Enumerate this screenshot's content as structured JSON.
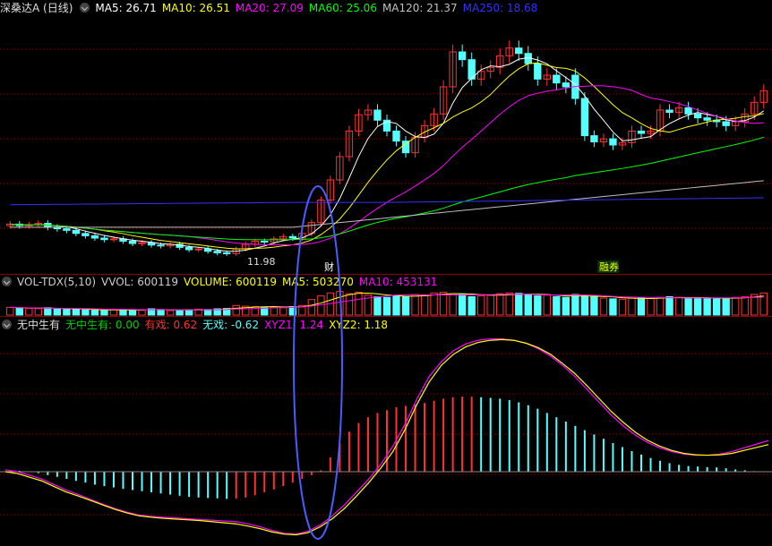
{
  "header": {
    "title": "深桑达A (日线)",
    "ma5": "MA5: 26.71",
    "ma10": "MA10: 26.51",
    "ma20": "MA20: 27.09",
    "ma60": "MA60: 25.06",
    "ma120": "MA120: 21.37",
    "ma250": "MA250: 18.68"
  },
  "volume_header": {
    "title": "VOL-TDX(5,10)",
    "vvol": "VVOL: 600119",
    "volume": "VOLUME: 600119",
    "ma5": "MA5: 503270",
    "ma10": "MA10: 453131"
  },
  "indicator_header": {
    "title": "无中生有",
    "wzsy": "无中生有: 0.00",
    "youxi": "有戏: 0.62",
    "wuxi": "无戏: -0.62",
    "xyz1": "XYZ1: 1.24",
    "xyz2": "XYZ2: 1.18"
  },
  "annotations": {
    "low_price": "11.98",
    "tag1": "财",
    "tag2": "融券"
  },
  "colors": {
    "up": "#ff3232",
    "down": "#54ffff",
    "ma5": "#ffffff",
    "ma10": "#ffff00",
    "ma20": "#ff00ff",
    "ma60": "#00ff00",
    "ma120": "#c0c0c0",
    "ma250": "#3232ff",
    "ellipse": "#4a5cff"
  },
  "chart_data": [
    {
      "type": "candlestick",
      "name": "price",
      "price_range": [
        11.98,
        40.5
      ],
      "closes": [
        15.8,
        15.6,
        15.7,
        15.9,
        15.4,
        15.2,
        15.0,
        14.6,
        14.3,
        14.0,
        13.8,
        13.9,
        13.6,
        13.3,
        13.4,
        13.1,
        13.0,
        13.2,
        12.8,
        12.5,
        12.6,
        12.3,
        12.1,
        11.98,
        12.6,
        13.2,
        13.6,
        13.5,
        13.9,
        14.2,
        14.0,
        14.6,
        16.0,
        18.9,
        21.5,
        24.5,
        27.8,
        29.9,
        30.5,
        29.2,
        27.8,
        26.5,
        25.0,
        27.0,
        28.5,
        30.0,
        33.5,
        38.0,
        37.0,
        34.5,
        35.5,
        36.0,
        37.5,
        38.5,
        37.8,
        36.5,
        34.5,
        35.0,
        34.0,
        33.5,
        32.0,
        27.2,
        26.4,
        26.8,
        26.0,
        26.3,
        27.8,
        27.5,
        27.8,
        30.5,
        30.2,
        30.8,
        30.0,
        29.5,
        29.2,
        29.0,
        28.5,
        29.0,
        30.0,
        31.5,
        33.0
      ],
      "opens": [
        15.6,
        15.8,
        15.6,
        15.7,
        15.9,
        15.4,
        15.2,
        15.0,
        14.6,
        14.3,
        14.0,
        13.8,
        13.9,
        13.6,
        13.3,
        13.4,
        13.1,
        13.0,
        13.2,
        12.8,
        12.5,
        12.6,
        12.3,
        12.1,
        12.0,
        12.6,
        13.2,
        13.6,
        13.5,
        13.9,
        14.2,
        14.0,
        14.6,
        16.0,
        18.9,
        21.5,
        24.5,
        27.8,
        29.9,
        30.5,
        29.2,
        27.8,
        26.5,
        25.0,
        27.0,
        28.5,
        30.0,
        33.5,
        38.0,
        37.0,
        34.5,
        35.5,
        36.0,
        37.5,
        38.5,
        37.8,
        36.5,
        34.5,
        35.0,
        34.0,
        35.0,
        32.0,
        27.2,
        26.4,
        26.8,
        26.0,
        26.3,
        27.8,
        27.5,
        27.8,
        30.5,
        30.2,
        30.8,
        30.0,
        29.5,
        29.2,
        29.0,
        28.5,
        29.0,
        30.0,
        31.5
      ]
    },
    {
      "type": "bar",
      "name": "volume",
      "values": [
        210,
        190,
        180,
        175,
        200,
        160,
        150,
        170,
        140,
        130,
        120,
        160,
        150,
        140,
        130,
        170,
        150,
        120,
        130,
        140,
        160,
        150,
        170,
        180,
        260,
        240,
        230,
        210,
        220,
        200,
        230,
        260,
        420,
        520,
        600,
        640,
        580,
        620,
        540,
        500,
        480,
        520,
        510,
        560,
        540,
        600,
        620,
        580,
        560,
        500,
        520,
        540,
        580,
        600,
        590,
        550,
        520,
        540,
        500,
        480,
        560,
        520,
        500,
        460,
        440,
        430,
        460,
        470,
        450,
        480,
        500,
        480,
        470,
        460,
        450,
        440,
        460,
        480,
        500,
        560,
        600
      ]
    },
    {
      "type": "bar",
      "name": "无中生有",
      "values": [
        0.05,
        0.03,
        0.0,
        -0.05,
        -0.12,
        -0.18,
        -0.25,
        -0.32,
        -0.38,
        -0.45,
        -0.5,
        -0.55,
        -0.6,
        -0.64,
        -0.68,
        -0.72,
        -0.76,
        -0.8,
        -0.84,
        -0.88,
        -0.9,
        -0.92,
        -0.93,
        -0.95,
        -0.94,
        -0.9,
        -0.82,
        -0.72,
        -0.62,
        -0.5,
        -0.38,
        -0.25,
        -0.12,
        0.05,
        0.5,
        1.0,
        1.4,
        1.7,
        1.9,
        2.05,
        2.15,
        2.25,
        2.3,
        2.35,
        2.4,
        2.48,
        2.55,
        2.6,
        2.62,
        2.62,
        2.6,
        2.58,
        2.55,
        2.5,
        2.42,
        2.32,
        2.2,
        2.05,
        1.9,
        1.75,
        1.6,
        1.45,
        1.3,
        1.15,
        1.0,
        0.86,
        0.72,
        0.6,
        0.48,
        0.38,
        0.3,
        0.24,
        0.2,
        0.18,
        0.16,
        0.15,
        0.12,
        0.08,
        0.05,
        0.02,
        0.0
      ],
      "xyz1": [
        0.05,
        0.0,
        -0.1,
        -0.2,
        -0.35,
        -0.5,
        -0.62,
        -0.75,
        -0.88,
        -1.0,
        -1.1,
        -1.18,
        -1.22,
        -1.24,
        -1.26,
        -1.28,
        -1.3,
        -1.32,
        -1.34,
        -1.36,
        -1.42,
        -1.5,
        -1.6,
        -1.68,
        -1.7,
        -1.62,
        -1.45,
        -1.2,
        -0.9,
        -0.55,
        -0.2,
        0.2,
        0.7,
        1.3,
        2.0,
        2.6,
        3.0,
        3.3,
        3.48,
        3.58,
        3.62,
        3.62,
        3.58,
        3.5,
        3.35,
        3.15,
        2.9,
        2.6,
        2.25,
        1.9,
        1.55,
        1.25,
        1.0,
        0.8,
        0.65,
        0.55,
        0.48,
        0.45,
        0.45,
        0.48,
        0.55,
        0.65,
        0.75,
        0.85
      ],
      "xyz2": [
        0.0,
        -0.05,
        -0.15,
        -0.25,
        -0.4,
        -0.55,
        -0.66,
        -0.78,
        -0.9,
        -1.02,
        -1.12,
        -1.2,
        -1.24,
        -1.27,
        -1.29,
        -1.31,
        -1.33,
        -1.36,
        -1.39,
        -1.42,
        -1.48,
        -1.55,
        -1.64,
        -1.7,
        -1.72,
        -1.66,
        -1.5,
        -1.28,
        -1.0,
        -0.66,
        -0.3,
        0.1,
        0.55,
        1.15,
        1.85,
        2.45,
        2.9,
        3.2,
        3.4,
        3.52,
        3.58,
        3.6,
        3.58,
        3.5,
        3.38,
        3.2,
        2.95,
        2.68,
        2.35,
        2.0,
        1.65,
        1.35,
        1.08,
        0.86,
        0.7,
        0.58,
        0.5,
        0.46,
        0.45,
        0.46,
        0.5,
        0.58,
        0.66,
        0.74
      ]
    }
  ]
}
